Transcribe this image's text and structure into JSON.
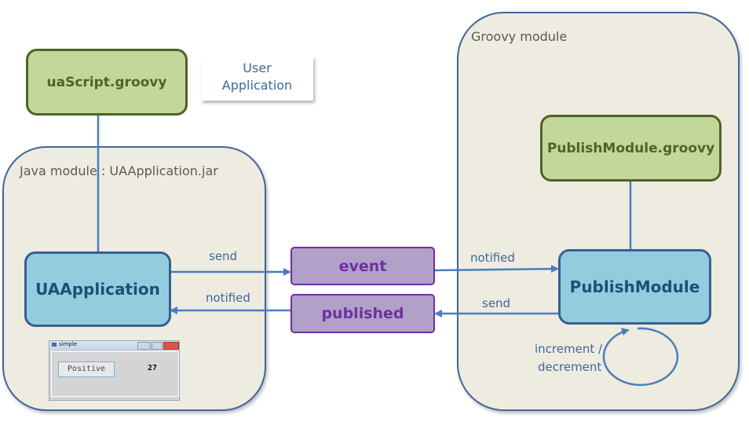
{
  "modules": {
    "java": {
      "title": "Java module : UAApplication.jar"
    },
    "groovy": {
      "title": "Groovy module"
    }
  },
  "boxes": {
    "ua_script": "uaScript.groovy",
    "ua_application": "UAApplication",
    "event": "event",
    "published": "published",
    "publish_module_script": "PublishModule.groovy",
    "publish_module": "PublishModule"
  },
  "note": {
    "line1": "User",
    "line2": "Application"
  },
  "arrow_labels": {
    "ua_send": "send",
    "ua_notified": "notified",
    "pm_notified": "notified",
    "pm_send": "send",
    "loop_line1": "increment /",
    "loop_line2": "decrement"
  },
  "app_window": {
    "title": "simple",
    "button_label": "Positive",
    "value": "27"
  },
  "colors": {
    "module_fill": "#eeebe0",
    "module_border": "#41679a",
    "script_fill": "#c4d79b",
    "component_fill": "#93cddd",
    "message_fill": "#b1a0c7",
    "arrow": "#4a7ebb"
  }
}
